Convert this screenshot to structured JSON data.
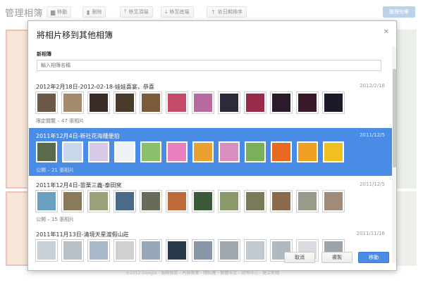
{
  "page": {
    "title": "管理相簿",
    "toolbar": {
      "move": "移動",
      "delete": "刪除",
      "move_top": "移至頂端",
      "move_bottom": "移至底端",
      "sort_date": "依日期排序",
      "done": "整理完畢"
    },
    "footer": "©2012 Google - 服務條款 - 內容政策 - 隱私權 - 繁體中文 - 說明中心 - 建立新相"
  },
  "dialog": {
    "title": "將相片移到其他相簿",
    "close_icon": "close-icon",
    "new_album_label": "新相簿",
    "new_album_placeholder": "輸入相簿名稱",
    "albums": [
      {
        "title": "2012年2月18日-2012-02-18-娃娃喜宴，恭喜",
        "date": "2012/2/18",
        "status": "限定閱覽 – 47 張相片",
        "selected": false,
        "thumbs": [
          "#6b5a4a",
          "#a38a6a",
          "#3a2c26",
          "#4a3a2a",
          "#7a5a3a",
          "#c44a6a",
          "#b86aa0",
          "#2a2a3a",
          "#9a2a4a",
          "#2a1a2a",
          "#3a1a2a",
          "#1a1a2a"
        ]
      },
      {
        "title": "2011年12月4日-新社花海賤便拍",
        "date": "2011/12/5",
        "status": "公開 – 21 張相片",
        "selected": true,
        "thumbs": [
          "#5a6a4a",
          "#c8d8e8",
          "#d8c8e8",
          "#eef2f6",
          "#8ac06a",
          "#e880c0",
          "#e8a030",
          "#d890c0",
          "#7ab05a",
          "#e86a20",
          "#f0a020",
          "#f0c020"
        ]
      },
      {
        "title": "2011年12月4日-苗栗三義-泰田窯",
        "date": "2011/12/5",
        "status": "公開 – 15 張相片",
        "selected": false,
        "thumbs": [
          "#6aa0c0",
          "#8a7a5a",
          "#9aa07a",
          "#4a6a8a",
          "#6a6a5a",
          "#c06a3a",
          "#3a5a3a",
          "#8a9a6a",
          "#7a7a5a",
          "#8a6a4a",
          "#9a9a8a",
          "#a08a7a"
        ]
      },
      {
        "title": "2011年11月13日-清境天星渡假山莊",
        "date": "2011/11/16",
        "status": "",
        "selected": false,
        "thumbs": [
          "#c8d0d8",
          "#b8c0c8",
          "#a8b8c8",
          "#d0d0d0",
          "#98a8b8",
          "#2a3a4a",
          "#8898a8",
          "#a0a8b0",
          "#c0c8d0",
          "#b0b8c0",
          "#d8dce0",
          "#9aa4ae"
        ]
      }
    ],
    "buttons": {
      "cancel": "取消",
      "copy": "複製",
      "move": "移動"
    }
  },
  "colors": {
    "accent": "#4a8be6",
    "selected_row": "#4a8be6"
  }
}
